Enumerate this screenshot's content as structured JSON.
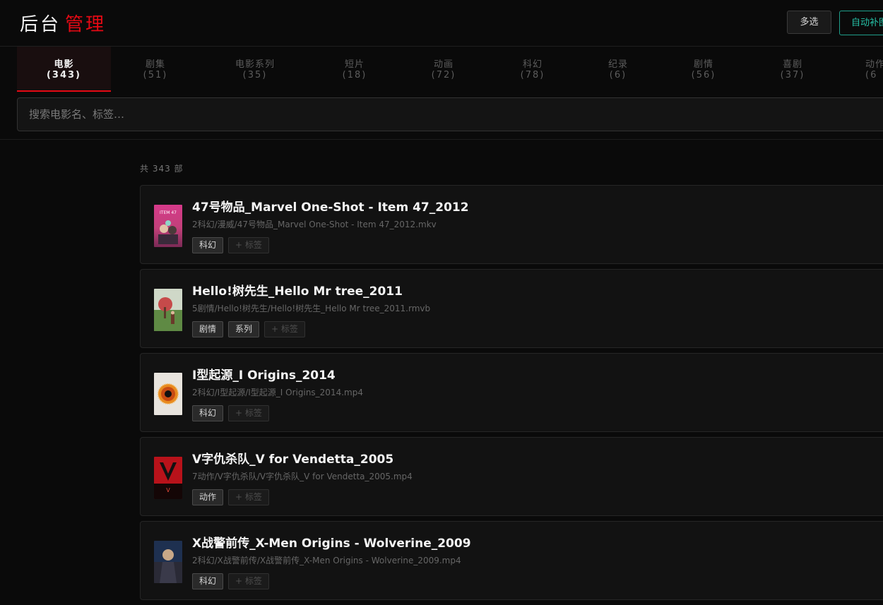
{
  "header": {
    "logo_main": "后台",
    "logo_accent": "管理",
    "multi_select_label": "多选",
    "auto_fill_label": "自动补图"
  },
  "tabs": [
    {
      "label": "电影",
      "count": "(343)"
    },
    {
      "label": "剧集",
      "count": "(51)"
    },
    {
      "label": "电影系列",
      "count": "(35)"
    },
    {
      "label": "短片",
      "count": "(18)"
    },
    {
      "label": "动画",
      "count": "(72)"
    },
    {
      "label": "科幻",
      "count": "(78)"
    },
    {
      "label": "纪录",
      "count": "(6)"
    },
    {
      "label": "剧情",
      "count": "(56)"
    },
    {
      "label": "喜剧",
      "count": "(37)"
    },
    {
      "label": "动作",
      "count": "(6"
    }
  ],
  "search": {
    "placeholder": "搜索电影名、标签…"
  },
  "total_text": "共 343 部",
  "add_tag_label": "+ 标签",
  "movies": [
    {
      "title": "47号物品_Marvel One-Shot - Item 47_2012",
      "path": "2科幻/漫威/47号物品_Marvel One-Shot - Item 47_2012.mkv",
      "tags": [
        "科幻"
      ],
      "poster_text": "ITEM 47"
    },
    {
      "title": "Hello!树先生_Hello Mr tree_2011",
      "path": "5剧情/Hello!树先生/Hello!树先生_Hello Mr tree_2011.rmvb",
      "tags": [
        "剧情",
        "系列"
      ]
    },
    {
      "title": "I型起源_I Origins_2014",
      "path": "2科幻/I型起源/I型起源_I Origins_2014.mp4",
      "tags": [
        "科幻"
      ]
    },
    {
      "title": "V字仇杀队_V for Vendetta_2005",
      "path": "7动作/V字仇杀队/V字仇杀队_V for Vendetta_2005.mp4",
      "tags": [
        "动作"
      ],
      "poster_text": "V"
    },
    {
      "title": "X战警前传_X-Men Origins - Wolverine_2009",
      "path": "2科幻/X战警前传/X战警前传_X-Men Origins - Wolverine_2009.mp4",
      "tags": [
        "科幻"
      ]
    }
  ]
}
